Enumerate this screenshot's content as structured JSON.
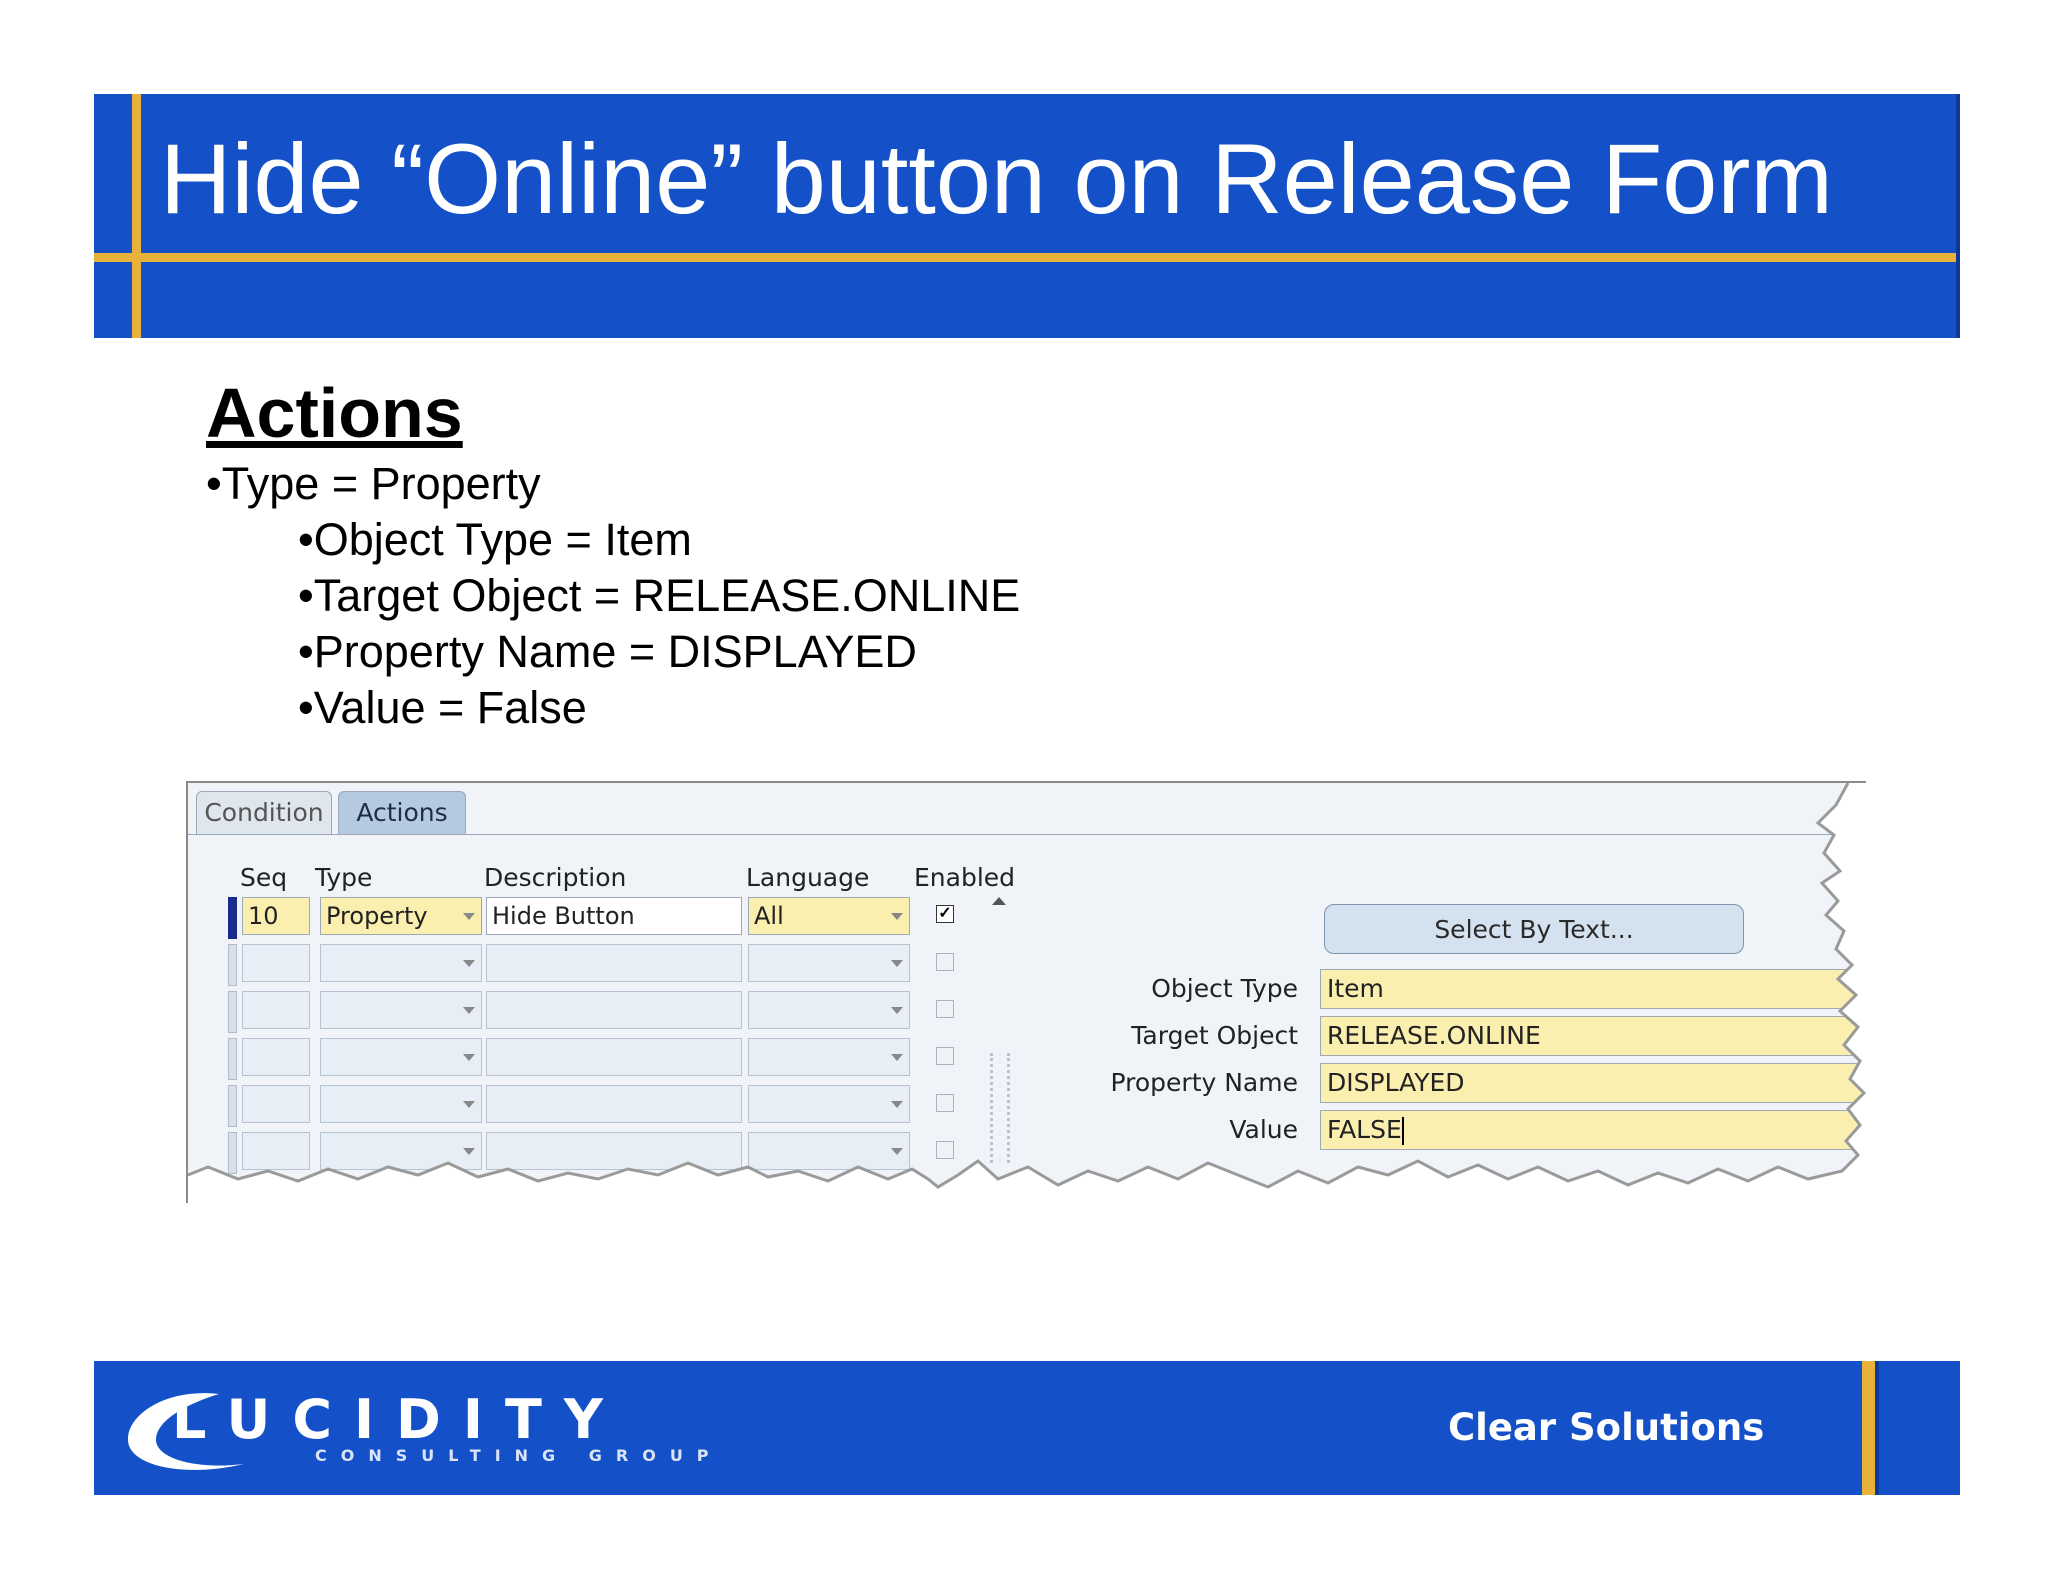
{
  "slide": {
    "title": "Hide “Online” button on Release Form",
    "heading": "Actions",
    "bullets": [
      "•Type = Property",
      "•Object Type = Item",
      "•Target Object = RELEASE.ONLINE",
      "•Property Name = DISPLAYED",
      "•Value = False"
    ]
  },
  "form": {
    "tabs": [
      "Condition",
      "Actions"
    ],
    "active_tab": "Actions",
    "columns": [
      "Seq",
      "Type",
      "Description",
      "Language",
      "Enabled"
    ],
    "rows": [
      {
        "seq": "10",
        "type": "Property",
        "description": "Hide Button",
        "language": "All",
        "enabled": true
      }
    ],
    "select_button": "Select By Text...",
    "fields": [
      {
        "label": "Object Type",
        "value": "Item"
      },
      {
        "label": "Target Object",
        "value": "RELEASE.ONLINE"
      },
      {
        "label": "Property Name",
        "value": "DISPLAYED"
      },
      {
        "label": "Value",
        "value": "FALSE"
      }
    ]
  },
  "footer": {
    "logo_word": "LUCIDITY",
    "logo_sub": "CONSULTING GROUP",
    "tagline": "Clear Solutions"
  },
  "colors": {
    "banner_blue": "#1450c8",
    "accent_gold": "#e8b23a",
    "field_yellow": "#fbefb0"
  }
}
